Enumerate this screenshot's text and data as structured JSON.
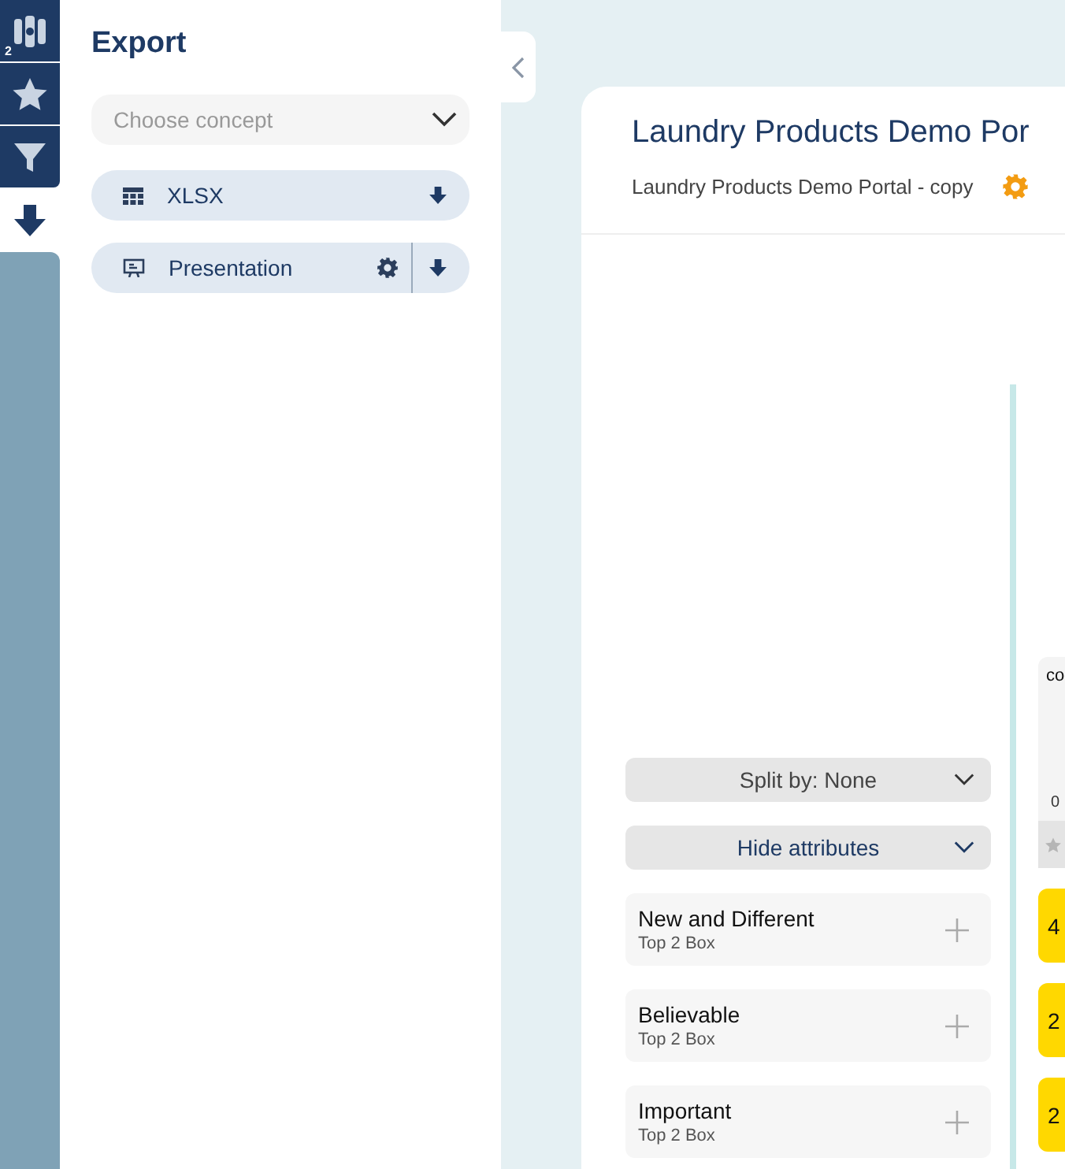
{
  "rail": [
    {
      "kind": "products",
      "badge": "2",
      "selected": false
    },
    {
      "kind": "star",
      "selected": false
    },
    {
      "kind": "filter",
      "selected": false
    },
    {
      "kind": "download",
      "selected": true
    }
  ],
  "export": {
    "title": "Export",
    "concept_select": {
      "placeholder": "Choose concept"
    },
    "options": [
      {
        "kind": "table",
        "label": "XLSX",
        "settings": false
      },
      {
        "kind": "presentation",
        "label": "Presentation",
        "settings": true
      }
    ]
  },
  "main": {
    "title": "Laundry Products Demo Por",
    "subtitle": "Laundry Products Demo Portal - copy",
    "split_by": "Split by: None",
    "attributes_toggle": "Hide attributes",
    "attributes": [
      {
        "name": "New and Different",
        "metric": "Top 2 Box"
      },
      {
        "name": "Believable",
        "metric": "Top 2 Box"
      },
      {
        "name": "Important",
        "metric": "Top 2 Box"
      }
    ],
    "concept_card": {
      "title": "co",
      "date": "0"
    },
    "scores": [
      "4",
      "2",
      "2"
    ]
  }
}
